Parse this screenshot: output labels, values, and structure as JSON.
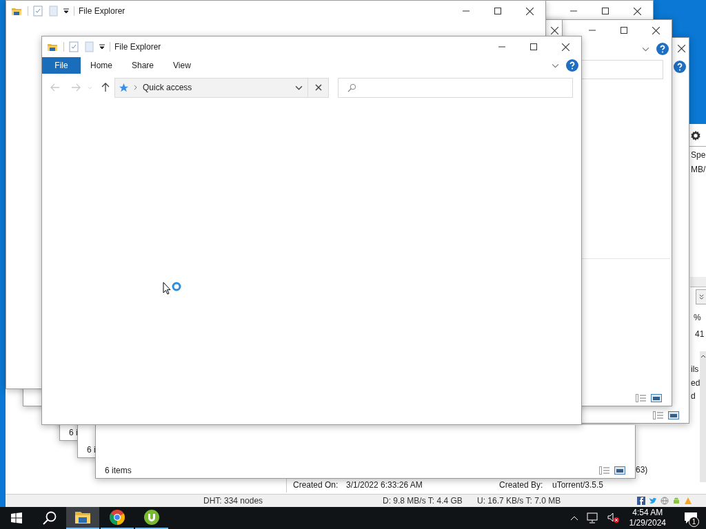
{
  "background_window": {
    "kind": "utorrent",
    "side_texts": [
      "Spe",
      "MB/",
      "%",
      "41",
      "ils",
      "ed",
      "d"
    ],
    "details": [
      {
        "label": "Created On:",
        "value": "3/1/2022 6:33:26 AM"
      },
      {
        "label": "Created By:",
        "value": "uTorrent/3.5.5"
      }
    ],
    "cut_text": "63)",
    "status_bar": [
      "DHT: 334 nodes",
      "D: 9.8 MB/s T: 4.4 GB",
      "U: 16.7 KB/s T: 7.0 MB"
    ]
  },
  "windows": [
    {
      "kind": "explorer",
      "title": "File Explorer",
      "ribbon_tabs": [
        {
          "label": "File",
          "kind": "menu"
        },
        {
          "label": "Home",
          "kind": "tab"
        },
        {
          "label": "Share",
          "kind": "tab"
        },
        {
          "label": "View",
          "kind": "tab"
        }
      ],
      "address": "Quick access"
    },
    {
      "kind": "explorer",
      "status": "6 items"
    },
    {
      "kind": "explorer",
      "status": "6 i"
    },
    {
      "kind": "explorer",
      "status": "6 i"
    },
    {
      "kind": "explorer",
      "title": "File Explorer"
    },
    {
      "kind": "explorer"
    },
    {
      "kind": "explorer"
    },
    {
      "kind": "explorer"
    },
    {
      "kind": "explorer"
    }
  ],
  "taskbar": {
    "apps": [
      {
        "kind": "explorer",
        "active": true
      },
      {
        "kind": "chrome",
        "active": false
      },
      {
        "kind": "utorrent",
        "active": false
      }
    ],
    "time": "4:54 AM",
    "date": "1/29/2024",
    "notification_count": "1"
  }
}
